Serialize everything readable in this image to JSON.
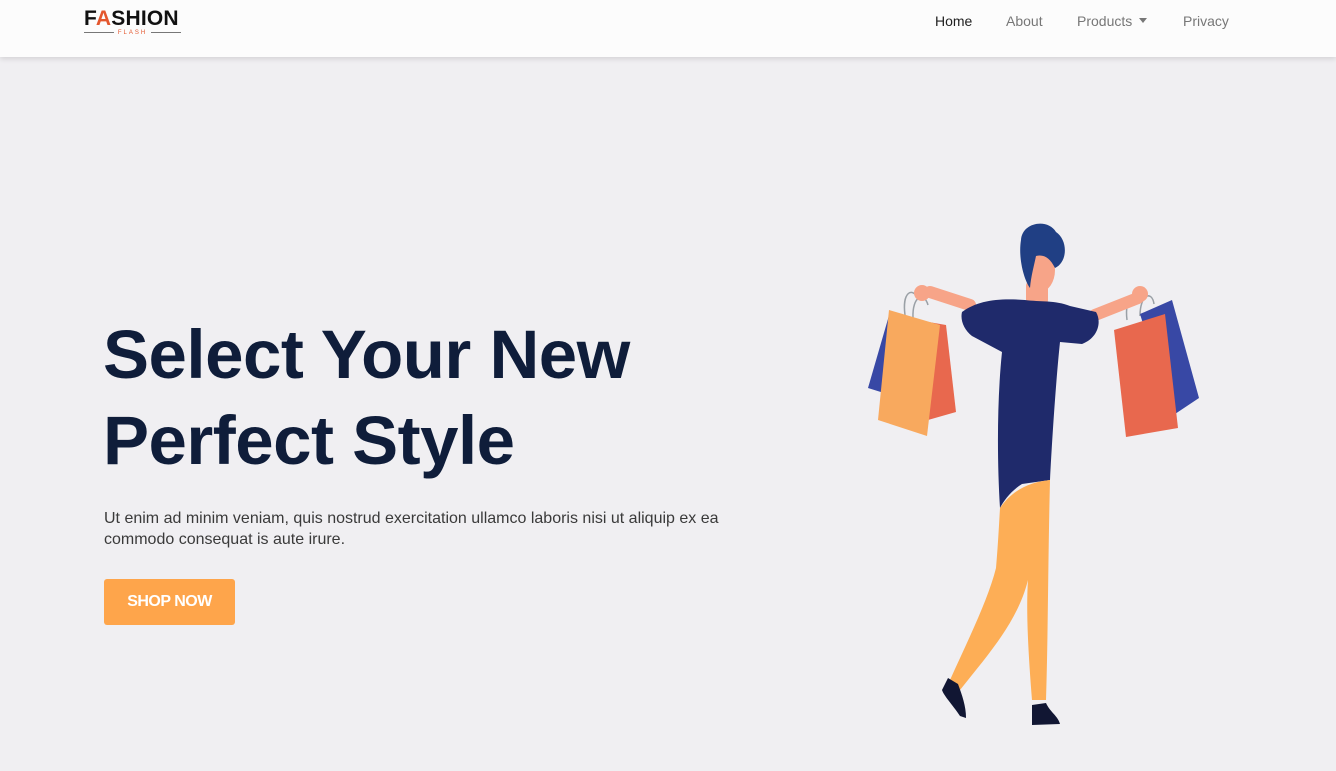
{
  "brand": {
    "name_prefix": "F",
    "name_accent": "A",
    "name_suffix": "SHION",
    "tagline": "FLASH",
    "accent_color": "#e4572e"
  },
  "nav": {
    "items": [
      {
        "label": "Home",
        "active": true
      },
      {
        "label": "About",
        "active": false
      },
      {
        "label": "Products",
        "active": false,
        "dropdown": true
      },
      {
        "label": "Privacy",
        "active": false
      }
    ]
  },
  "hero": {
    "title_line1": "Select Your New",
    "title_line2": "Perfect Style",
    "text": "Ut enim ad minim veniam, quis nostrud exercitation ullamco laboris nisi ut aliquip ex ea commodo consequat is aute irure.",
    "button_label": "SHOP NOW",
    "button_color": "#fea54b",
    "title_color": "#0f1d3a"
  },
  "illustration": {
    "icon": "shopping-person-illustration",
    "colors": {
      "shirt": "#1f2a6b",
      "pants": "#fdae56",
      "hair": "#203f84",
      "skin": "#f7a488",
      "bag_orange": "#f8a95e",
      "bag_red": "#e8684e",
      "bag_blue": "#3848a5"
    }
  }
}
